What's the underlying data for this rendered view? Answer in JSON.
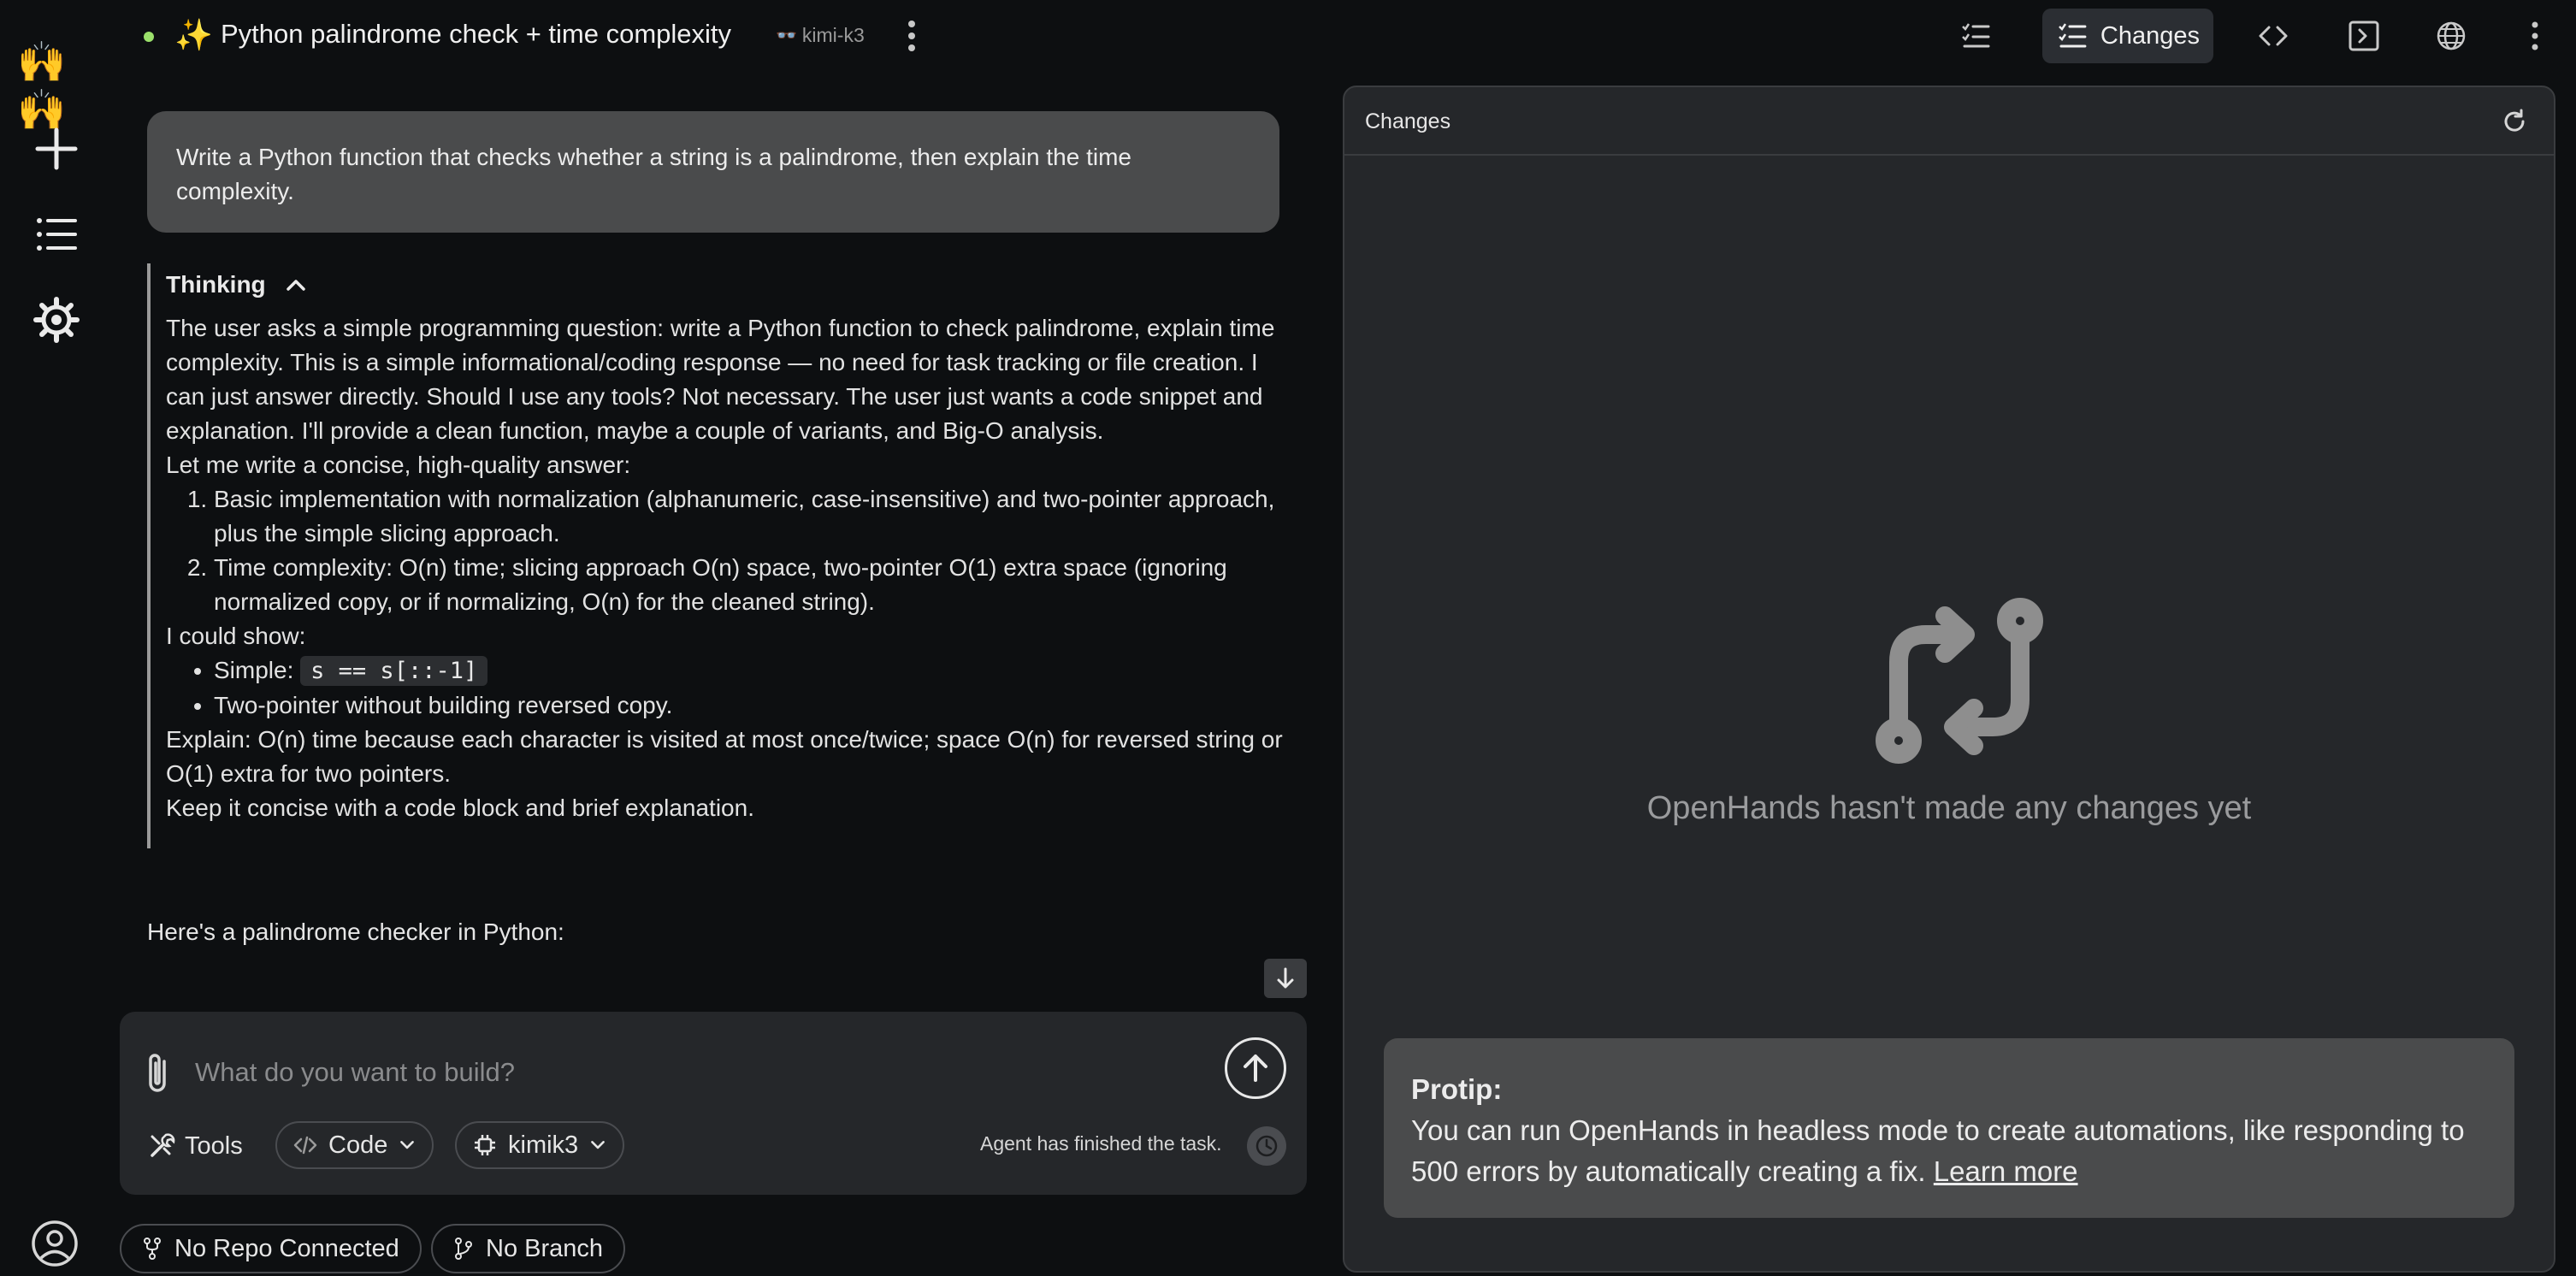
{
  "app": {
    "conversation_title": "Python palindrome check + time complexity",
    "title_emoji": "✨",
    "model_tag": "kimi-k3",
    "model_glyph": "👓"
  },
  "rail": {
    "logo_emoji": "🙌",
    "new_label": "+",
    "icons": [
      "hands-logo-icon",
      "plus-icon",
      "list-icon",
      "gear-icon",
      "user-circle-icon"
    ]
  },
  "topbar": {
    "active_tab_label": "Changes",
    "icons": [
      "tasks-icon",
      "changes-icon",
      "code-icon",
      "terminal-icon",
      "globe-icon",
      "kebab-icon"
    ]
  },
  "chat": {
    "user_message": "Write a Python function that checks whether a string is a palindrome, then explain the time complexity.",
    "thinking": {
      "label": "Thinking",
      "para1": "The user asks a simple programming question: write a Python function to check palindrome, explain time complexity. This is a simple informational/coding response — no need for task tracking or file creation. I can just answer directly. Should I use any tools? Not necessary. The user just wants a code snippet and explanation. I'll provide a clean function, maybe a couple of variants, and Big-O analysis.",
      "para2": "Let me write a concise, high-quality answer:",
      "ordered": [
        "Basic implementation with normalization (alphanumeric, case-insensitive) and two-pointer approach, plus the simple slicing approach.",
        "Time complexity: O(n) time; slicing approach O(n) space, two-pointer O(1) extra space (ignoring normalized copy, or if normalizing, O(n) for the cleaned string)."
      ],
      "para3": "I could show:",
      "bullet1_prefix": "Simple: ",
      "bullet1_code": "s == s[::-1]",
      "bullet2": "Two-pointer without building reversed copy.",
      "para4": "Explain: O(n) time because each character is visited at most once/twice; space O(n) for reversed string or O(1) extra for two pointers.",
      "para5": "Keep it concise with a code block and brief explanation."
    },
    "reply_start": "Here's a palindrome checker in Python:"
  },
  "composer": {
    "placeholder": "What do you want to build?",
    "tools_label": "Tools",
    "mode_label": "Code",
    "model_label": "kimik3",
    "agent_status": "Agent has finished the task."
  },
  "footer": {
    "repo_label": "No Repo Connected",
    "branch_label": "No Branch"
  },
  "panel": {
    "title": "Changes",
    "empty_message": "OpenHands hasn't made any changes yet",
    "protip_title": "Protip:",
    "protip_text": "You can run OpenHands in headless mode to create automations, like responding to 500 errors by automatically creating a fix.",
    "protip_link": "Learn more"
  },
  "colors": {
    "background": "#0d0f11",
    "panel": "#25272a",
    "bubble": "#4a4b4c",
    "status_dot": "#9be06b",
    "muted_text": "#9a9b9d"
  }
}
